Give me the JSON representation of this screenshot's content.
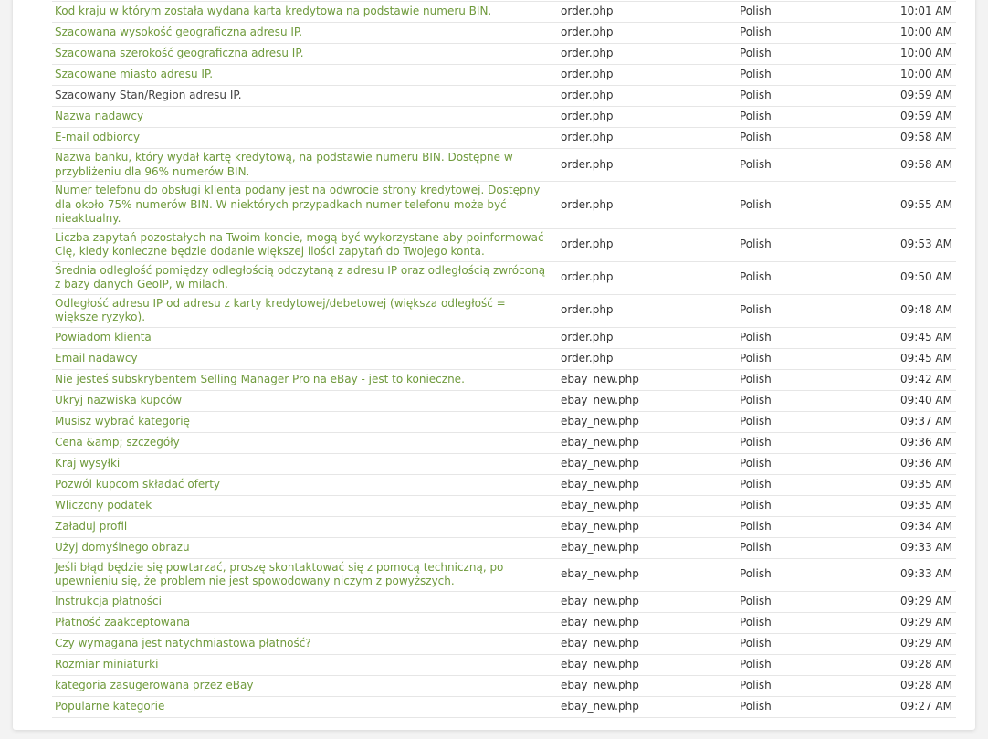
{
  "colors": {
    "link": "#6f9a3c",
    "text": "#333333",
    "border": "#e6e6e6",
    "background": "#f3f3f3"
  },
  "rows": [
    {
      "text": "Kod kraju w którym została wydana karta kredytowa na podstawie numeru BIN.",
      "file": "order.php",
      "language": "Polish",
      "time": "10:01 AM",
      "link": true
    },
    {
      "text": "Szacowana wysokość geograficzna adresu IP.",
      "file": "order.php",
      "language": "Polish",
      "time": "10:00 AM",
      "link": true
    },
    {
      "text": "Szacowana szerokość geograficzna adresu IP.",
      "file": "order.php",
      "language": "Polish",
      "time": "10:00 AM",
      "link": true
    },
    {
      "text": "Szacowane miasto adresu IP.",
      "file": "order.php",
      "language": "Polish",
      "time": "10:00 AM",
      "link": true
    },
    {
      "text": "Szacowany Stan/Region adresu IP.",
      "file": "order.php",
      "language": "Polish",
      "time": "09:59 AM",
      "link": false
    },
    {
      "text": "Nazwa nadawcy",
      "file": "order.php",
      "language": "Polish",
      "time": "09:59 AM",
      "link": true
    },
    {
      "text": "E-mail odbiorcy",
      "file": "order.php",
      "language": "Polish",
      "time": "09:58 AM",
      "link": true
    },
    {
      "text": "Nazwa banku, który wydał kartę kredytową, na podstawie numeru BIN. Dostępne w przybliżeniu dla 96% numerów BIN.",
      "file": "order.php",
      "language": "Polish",
      "time": "09:58 AM",
      "link": true
    },
    {
      "text": "Numer telefonu do obsługi klienta podany jest na odwrocie strony kredytowej. Dostępny dla około 75% numerów BIN. W niektórych przypadkach numer telefonu może być nieaktualny.",
      "file": "order.php",
      "language": "Polish",
      "time": "09:55 AM",
      "link": true
    },
    {
      "text": "Liczba zapytań pozostałych na Twoim koncie, mogą być wykorzystane aby poinformować Cię, kiedy konieczne będzie dodanie większej ilości zapytań do Twojego konta.",
      "file": "order.php",
      "language": "Polish",
      "time": "09:53 AM",
      "link": true
    },
    {
      "text": "Średnia odległość pomiędzy odległością odczytaną z adresu IP oraz odległością zwróconą z bazy danych GeoIP, w milach.",
      "file": "order.php",
      "language": "Polish",
      "time": "09:50 AM",
      "link": true
    },
    {
      "text": "Odległość adresu IP od adresu z karty kredytowej/debetowej (większa odległość = większe ryzyko).",
      "file": "order.php",
      "language": "Polish",
      "time": "09:48 AM",
      "link": true
    },
    {
      "text": "Powiadom klienta",
      "file": "order.php",
      "language": "Polish",
      "time": "09:45 AM",
      "link": true
    },
    {
      "text": "Email nadawcy",
      "file": "order.php",
      "language": "Polish",
      "time": "09:45 AM",
      "link": true
    },
    {
      "text": "Nie jesteś subskrybentem Selling Manager Pro na eBay - jest to konieczne.",
      "file": "ebay_new.php",
      "language": "Polish",
      "time": "09:42 AM",
      "link": true
    },
    {
      "text": "Ukryj nazwiska kupców",
      "file": "ebay_new.php",
      "language": "Polish",
      "time": "09:40 AM",
      "link": true
    },
    {
      "text": "Musisz wybrać kategorię",
      "file": "ebay_new.php",
      "language": "Polish",
      "time": "09:37 AM",
      "link": true
    },
    {
      "text": "Cena &amp; szczegóły",
      "file": "ebay_new.php",
      "language": "Polish",
      "time": "09:36 AM",
      "link": true
    },
    {
      "text": "Kraj wysyłki",
      "file": "ebay_new.php",
      "language": "Polish",
      "time": "09:36 AM",
      "link": true
    },
    {
      "text": "Pozwól kupcom składać oferty",
      "file": "ebay_new.php",
      "language": "Polish",
      "time": "09:35 AM",
      "link": true
    },
    {
      "text": "Wliczony podatek",
      "file": "ebay_new.php",
      "language": "Polish",
      "time": "09:35 AM",
      "link": true
    },
    {
      "text": "Załaduj profil",
      "file": "ebay_new.php",
      "language": "Polish",
      "time": "09:34 AM",
      "link": true
    },
    {
      "text": "Użyj domyślnego obrazu",
      "file": "ebay_new.php",
      "language": "Polish",
      "time": "09:33 AM",
      "link": true
    },
    {
      "text": "Jeśli błąd będzie się powtarzać, proszę skontaktować się z pomocą techniczną, po upewnieniu się, że problem nie jest spowodowany niczym z powyższych.",
      "file": "ebay_new.php",
      "language": "Polish",
      "time": "09:33 AM",
      "link": true
    },
    {
      "text": "Instrukcja płatności",
      "file": "ebay_new.php",
      "language": "Polish",
      "time": "09:29 AM",
      "link": true
    },
    {
      "text": "Płatność zaakceptowana",
      "file": "ebay_new.php",
      "language": "Polish",
      "time": "09:29 AM",
      "link": true
    },
    {
      "text": "Czy wymagana jest natychmiastowa płatność?",
      "file": "ebay_new.php",
      "language": "Polish",
      "time": "09:29 AM",
      "link": true
    },
    {
      "text": "Rozmiar miniaturki",
      "file": "ebay_new.php",
      "language": "Polish",
      "time": "09:28 AM",
      "link": true
    },
    {
      "text": "kategoria zasugerowana przez eBay",
      "file": "ebay_new.php",
      "language": "Polish",
      "time": "09:28 AM",
      "link": true
    },
    {
      "text": "Popularne kategorie",
      "file": "ebay_new.php",
      "language": "Polish",
      "time": "09:27 AM",
      "link": true
    }
  ]
}
